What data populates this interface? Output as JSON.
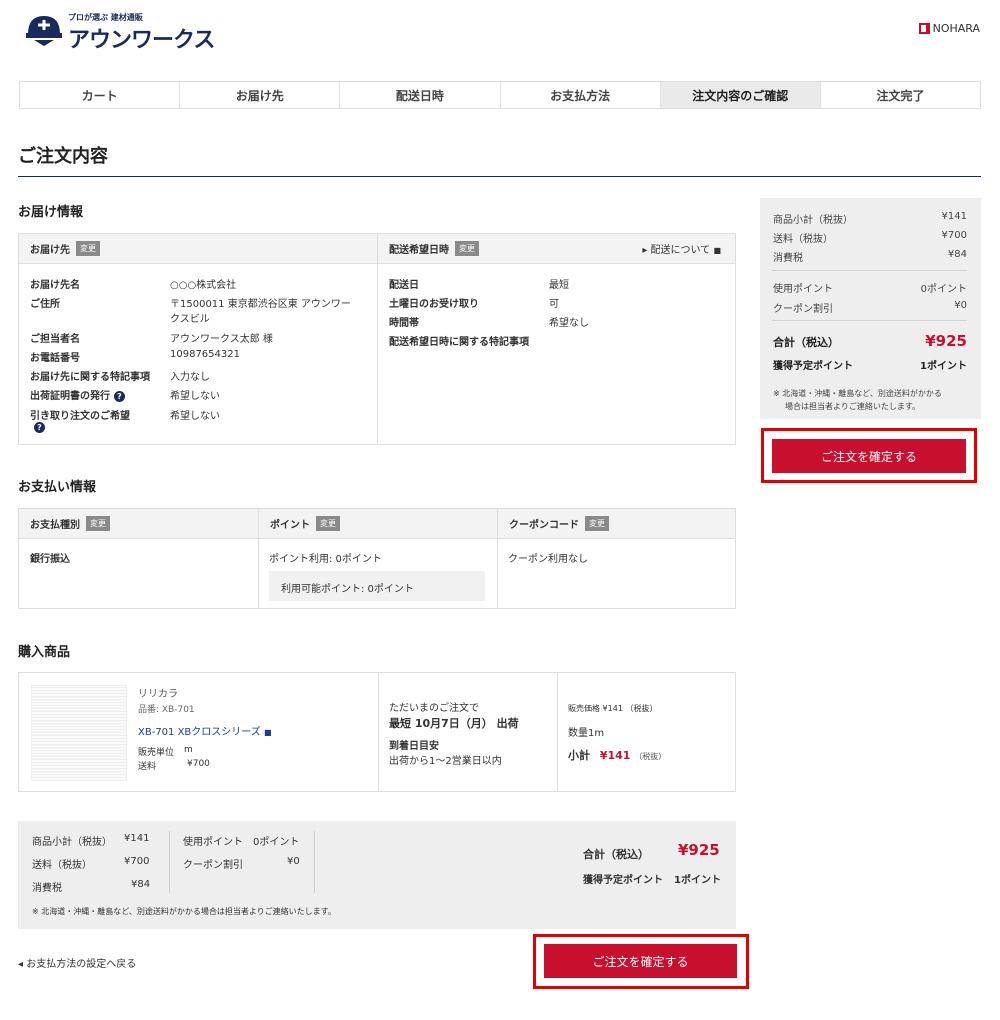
{
  "header": {
    "tagline": "プロが選ぶ 建材通販",
    "brand": "アウンワークス",
    "partner": "NOHARA"
  },
  "steps": [
    {
      "label": "カート"
    },
    {
      "label": "お届け先"
    },
    {
      "label": "配送日時"
    },
    {
      "label": "お支払方法"
    },
    {
      "label": "注文内容のご確認"
    },
    {
      "label": "注文完了"
    }
  ],
  "page_title": "ご注文内容",
  "delivery": {
    "section_title": "お届け情報",
    "dest_header": "お届け先",
    "change": "変更",
    "date_header": "配送希望日時",
    "about_link": "配送について",
    "dest_rows": [
      {
        "k": "お届け先名",
        "v": "○○○株式会社"
      },
      {
        "k": "ご住所",
        "v": "〒1500011 東京都渋谷区東 アウンワー",
        "v2": "クスビル"
      },
      {
        "k": "ご担当者名",
        "v": "アウンワークス太郎 様"
      },
      {
        "k": "お電話番号",
        "v": "10987654321"
      },
      {
        "k": "お届け先に関する特記事項",
        "v": "入力なし"
      },
      {
        "k": "出荷証明書の発行",
        "v": "希望しない"
      },
      {
        "k": "引き取り注文のご希望",
        "v": "希望しない"
      }
    ],
    "date_rows": [
      {
        "k": "配送日",
        "v": "最短"
      },
      {
        "k": "土曜日のお受け取り",
        "v": "可"
      },
      {
        "k": "時間帯",
        "v": "希望なし"
      },
      {
        "k": "配送希望日時に関する特記事項",
        "v": ""
      }
    ]
  },
  "payment": {
    "section_title": "お支払い情報",
    "type_header": "お支払種別",
    "point_header": "ポイント",
    "coupon_header": "クーポンコード",
    "change": "変更",
    "type_value": "銀行振込",
    "point_value": "ポイント利用: 0ポイント",
    "point_available": "利用可能ポイント: 0ポイント",
    "coupon_value": "クーポン利用なし"
  },
  "products": {
    "section_title": "購入商品",
    "maker": "リリカラ",
    "code": "品番: XB-701",
    "name": "XB-701 XBクロスシリーズ",
    "unit_label": "販売単位",
    "unit_value": "m",
    "ship_label": "送料",
    "ship_value": "¥700",
    "ship_note": "ただいまのご注文で",
    "ship_date": "最短 10月7日（月） 出荷",
    "arrival_label": "到着日目安",
    "arrival_value": "出荷から1〜2営業日以内",
    "price_label": "販売価格",
    "price_value": "¥141",
    "tax_ex": "（税抜）",
    "qty": "数量1m",
    "subtotal_label": "小計",
    "subtotal_value": "¥141"
  },
  "summary": {
    "subtotal_label": "商品小計（税抜）",
    "subtotal": "¥141",
    "shipping_label": "送料（税抜）",
    "shipping": "¥700",
    "tax_label": "消費税",
    "tax": "¥84",
    "points_label": "使用ポイント",
    "points": "0ポイント",
    "coupon_label": "クーポン割引",
    "coupon": "¥0",
    "total_label": "合計（税込）",
    "total": "¥925",
    "earn_label": "獲得予定ポイント",
    "earn": "1ポイント",
    "note": "※ 北海道・沖縄・離島など、別途送料がかかる場合は担当者よりご連絡いたします。",
    "note_a": "※ 北海道・沖縄・離島など、別途送料がかかる",
    "note_b": "場合は担当者よりご連絡いたします。"
  },
  "confirm_button": "ご注文を確定する",
  "back_link": "お支払方法の設定へ戻る"
}
